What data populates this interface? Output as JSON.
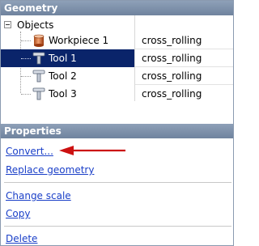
{
  "geometry": {
    "header": "Geometry",
    "root": "Objects",
    "rows": [
      {
        "name": "Workpiece 1",
        "value": "cross_rolling",
        "icon": "workpiece-cylinder-icon",
        "selected": false
      },
      {
        "name": "Tool 1",
        "value": "cross_rolling",
        "icon": "tool-icon",
        "selected": true
      },
      {
        "name": "Tool 2",
        "value": "cross_rolling",
        "icon": "tool-icon",
        "selected": false
      },
      {
        "name": "Tool 3",
        "value": "cross_rolling",
        "icon": "tool-icon",
        "selected": false
      }
    ]
  },
  "properties": {
    "header": "Properties",
    "convert": "Convert...",
    "replace": "Replace geometry",
    "change_scale": "Change scale",
    "copy": "Copy",
    "delete": "Delete"
  },
  "colors": {
    "selection": "#0a246a",
    "link": "#1a3fc8",
    "arrow": "#cc1111"
  }
}
